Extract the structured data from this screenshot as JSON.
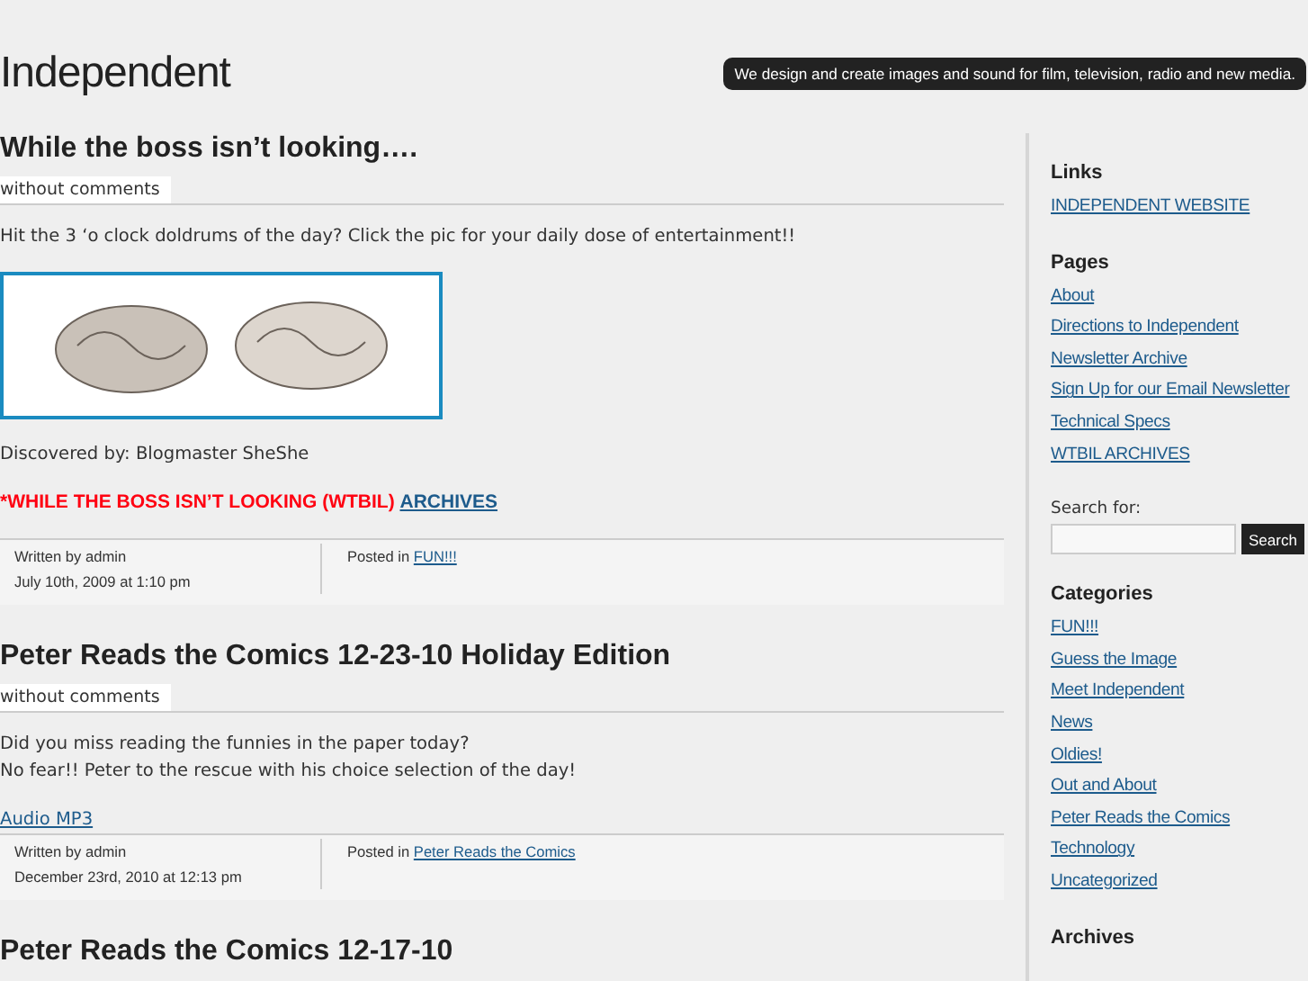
{
  "site": {
    "title": "Independent",
    "tagline": "We design and create images and sound for film, television, radio and new media."
  },
  "posts": [
    {
      "title": "While the boss isn’t looking….",
      "comments": "without comments",
      "blocks": [
        {
          "kind": "text",
          "lines": [
            "Hit the 3 ‘o clock doldrums of the day? Click the pic for your daily dose of entertainment!!"
          ]
        },
        {
          "kind": "image"
        },
        {
          "kind": "text",
          "lines": [
            "Discovered by: Blogmaster SheShe"
          ]
        },
        {
          "kind": "notice",
          "text": "*WHILE THE BOSS ISN’T LOOKING (WTBIL)",
          "link": "ARCHIVES"
        }
      ],
      "meta": {
        "author": "Written by admin",
        "date": "July 10th, 2009 at 1:10 pm",
        "posted_in": "Posted in",
        "category": "FUN!!!"
      }
    },
    {
      "title": "Peter Reads the Comics 12-23-10 Holiday Edition",
      "comments": "without comments",
      "blocks": [
        {
          "kind": "text",
          "lines": [
            "Did you miss reading the funnies in the paper today?",
            "No fear!! Peter to the rescue with his choice selection of the day!"
          ]
        },
        {
          "kind": "link",
          "text": "Audio MP3"
        }
      ],
      "meta": {
        "author": "Written by admin",
        "date": "December 23rd, 2010 at 12:13 pm",
        "posted_in": "Posted in",
        "category": "Peter Reads the Comics"
      }
    },
    {
      "title": "Peter Reads the Comics 12-17-10"
    }
  ],
  "sidebar": [
    {
      "kind": "links",
      "heading": "Links",
      "links": [
        "INDEPENDENT WEBSITE"
      ]
    },
    {
      "kind": "links",
      "heading": "Pages",
      "links": [
        "About",
        "Directions to Independent",
        "Newsletter Archive",
        "Sign Up for our Email Newsletter",
        "Technical Specs",
        "WTBIL ARCHIVES"
      ]
    },
    {
      "kind": "search",
      "label": "Search for:",
      "button": "Search"
    },
    {
      "kind": "links",
      "heading": "Categories",
      "links": [
        "FUN!!!",
        "Guess the Image",
        "Meet Independent",
        "News",
        "Oldies!",
        "Out and About",
        "Peter Reads the Comics",
        "Technology",
        "Uncategorized"
      ]
    },
    {
      "kind": "links",
      "heading": "Archives"
    }
  ]
}
